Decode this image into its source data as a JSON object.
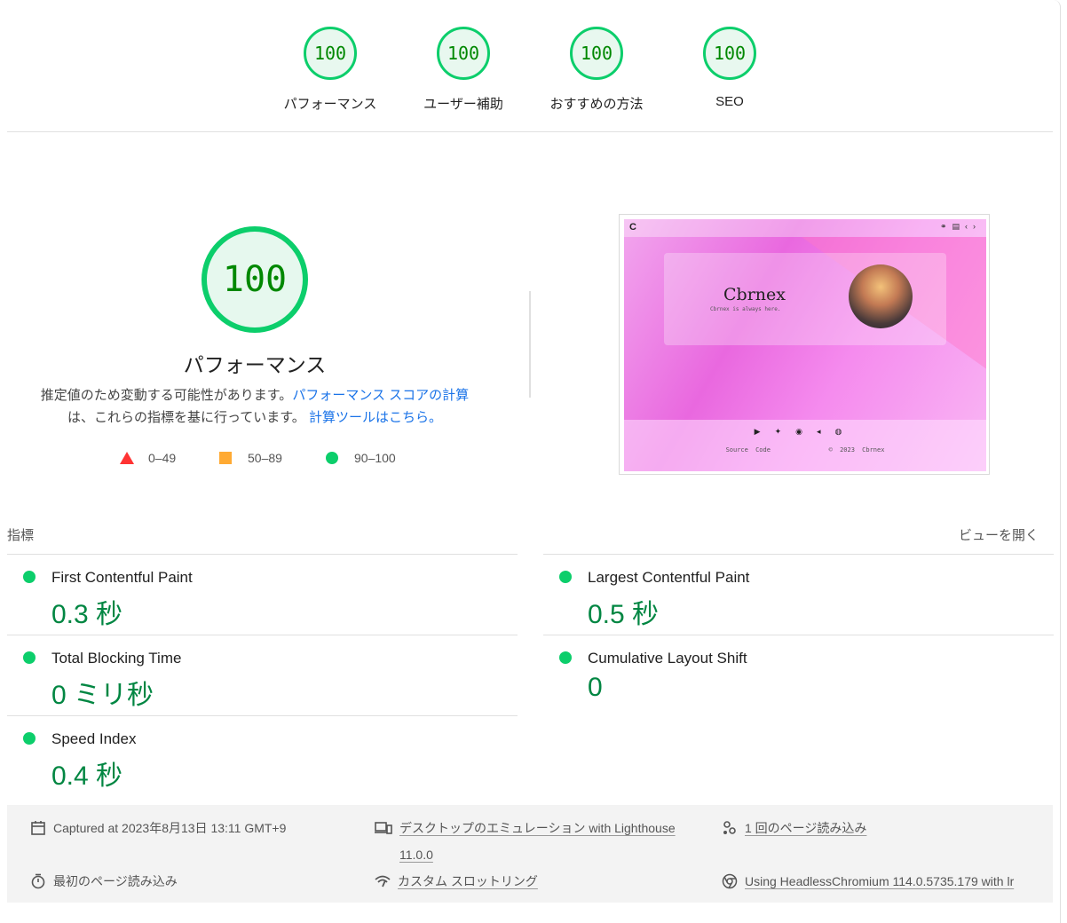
{
  "top_gauges": [
    {
      "score": "100",
      "label": "パフォーマンス"
    },
    {
      "score": "100",
      "label": "ユーザー補助"
    },
    {
      "score": "100",
      "label": "おすすめの方法"
    },
    {
      "score": "100",
      "label": "SEO"
    }
  ],
  "main": {
    "score": "100",
    "title": "パフォーマンス",
    "desc_prefix": "推定値のため変動する可能性があります。",
    "desc_link": "パフォーマンス スコアの計算",
    "desc_middle": "は、これらの指標を基に行っています。",
    "calc_link": "計算ツールはこちら。"
  },
  "legend": [
    {
      "range": "0–49",
      "shape": "triangle",
      "color": "#ff3333"
    },
    {
      "range": "50–89",
      "shape": "square",
      "color": "#ffaa33"
    },
    {
      "range": "90–100",
      "shape": "circle",
      "color": "#0cce6b"
    }
  ],
  "screenshot": {
    "name": "Cbrnex",
    "tagline": "Cbrnex is always here.",
    "source_link": "Source Code",
    "copyright": "© 2023 Cbrnex",
    "social_icons": [
      "youtube-icon",
      "twitter-icon",
      "pinterest-icon",
      "telegram-icon",
      "discord-icon"
    ]
  },
  "metrics": {
    "heading": "指標",
    "toggle": "ビューを開く",
    "items": [
      {
        "title": "First Contentful Paint",
        "value": "0.3 秒"
      },
      {
        "title": "Largest Contentful Paint",
        "value": "0.5 秒"
      },
      {
        "title": "Total Blocking Time",
        "value": "0 ミリ秒"
      },
      {
        "title": "Cumulative Layout Shift",
        "value": "0"
      },
      {
        "title": "Speed Index",
        "value": "0.4 秒"
      }
    ]
  },
  "runtime": {
    "captured": "Captured at 2023年8月13日 13:11 GMT+9",
    "emulation_line1": "デスクトップのエミュレーション with Lighthouse",
    "emulation_line2": "11.0.0",
    "page_loads": "1 回のページ読み込み",
    "initial_load": "最初のページ読み込み",
    "throttling": "カスタム スロットリング",
    "browser": "Using HeadlessChromium 114.0.5735.179 with lr"
  },
  "colors": {
    "pass": "#0cce6b",
    "pass_text": "#018642",
    "link": "#1a73e8"
  }
}
